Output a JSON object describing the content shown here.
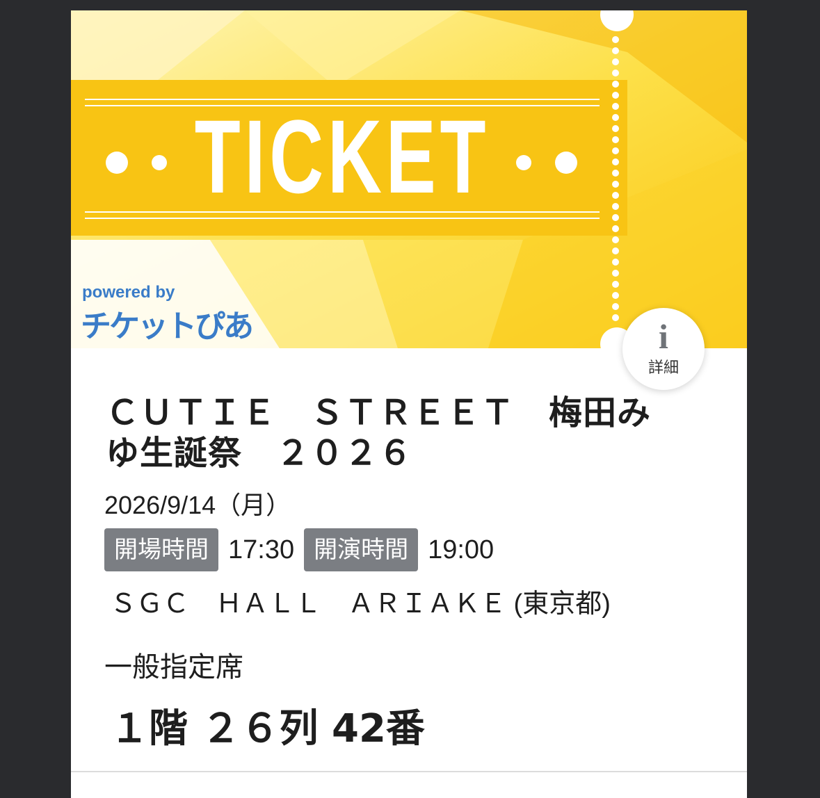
{
  "banner": {
    "heading": "TICKET",
    "powered_by": "powered by",
    "logo_text": "チケットぴあ",
    "colors": {
      "yellow": "#fbd63a",
      "ribbon": "#f7c20f",
      "logo_blue": "#3a7cc8"
    }
  },
  "info_button": {
    "icon": "info-icon",
    "label": "詳細"
  },
  "event": {
    "title": "ＣＵＴＩＥ　ＳＴＲＥＥＴ　梅田みゆ生誕祭　２０２６",
    "date": "2026/9/14（月）",
    "open_label": "開場時間",
    "open_time": "17:30",
    "start_label": "開演時間",
    "start_time": "19:00",
    "venue": "ＳＧＣ　ＨＡＬＬ　ＡＲＩＡＫＥ (東京都)"
  },
  "seat": {
    "type": "一般指定席",
    "location": "１階 ２６列 42番"
  }
}
